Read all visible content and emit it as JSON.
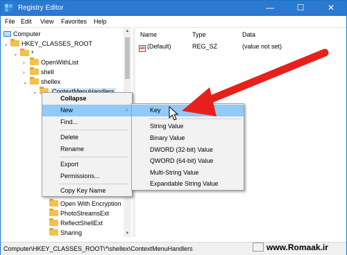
{
  "window": {
    "title": "Registry Editor",
    "controls": {
      "minimize": "—",
      "maximize": "☐",
      "close": "✕"
    }
  },
  "menubar": [
    "File",
    "Edit",
    "View",
    "Favorites",
    "Help"
  ],
  "tree": {
    "items": [
      {
        "label": "Computer",
        "expander": ""
      },
      {
        "label": "HKEY_CLASSES_ROOT",
        "expander": "⌄"
      },
      {
        "label": "*",
        "expander": "⌄"
      },
      {
        "label": "OpenWithList",
        "expander": "›"
      },
      {
        "label": "shell",
        "expander": "›"
      },
      {
        "label": "shellex",
        "expander": "⌄"
      },
      {
        "label": "ContextMenuHandlers",
        "expander": "⌄"
      },
      {
        "label": "Open With Encryption",
        "expander": ""
      },
      {
        "label": "PhotoStreamsExt",
        "expander": ""
      },
      {
        "label": "ReflectShellExt",
        "expander": ""
      },
      {
        "label": "Sharing",
        "expander": ""
      }
    ]
  },
  "list": {
    "columns": [
      "Name",
      "Type",
      "Data"
    ],
    "rows": [
      {
        "icon": "ab",
        "name": "(Default)",
        "type": "REG_SZ",
        "data": "(value not set)"
      }
    ]
  },
  "context_menu": {
    "items": [
      "Collapse",
      "New",
      "Find...",
      "Delete",
      "Rename",
      "Export",
      "Permissions...",
      "Copy Key Name"
    ],
    "new_arrow": "›"
  },
  "submenu": {
    "items": [
      "Key",
      "String Value",
      "Binary Value",
      "DWORD (32-bit) Value",
      "QWORD (64-bit) Value",
      "Multi-String Value",
      "Expandable String Value"
    ]
  },
  "statusbar": {
    "path": "Computer\\HKEY_CLASSES_ROOT\\*\\shellex\\ContextMenuHandlers"
  },
  "watermark": "www.Romaak.ir",
  "colors": {
    "titlebar": "#2b79d0",
    "highlight": "#91c9f7",
    "arrow": "#e8201c"
  },
  "icons": {
    "app": "registry-editor-icon",
    "folder": "folder-icon",
    "computer": "computer-icon",
    "value": "string-value-icon",
    "annotation": "red-arrow-icon",
    "cursor": "mouse-pointer-icon"
  }
}
